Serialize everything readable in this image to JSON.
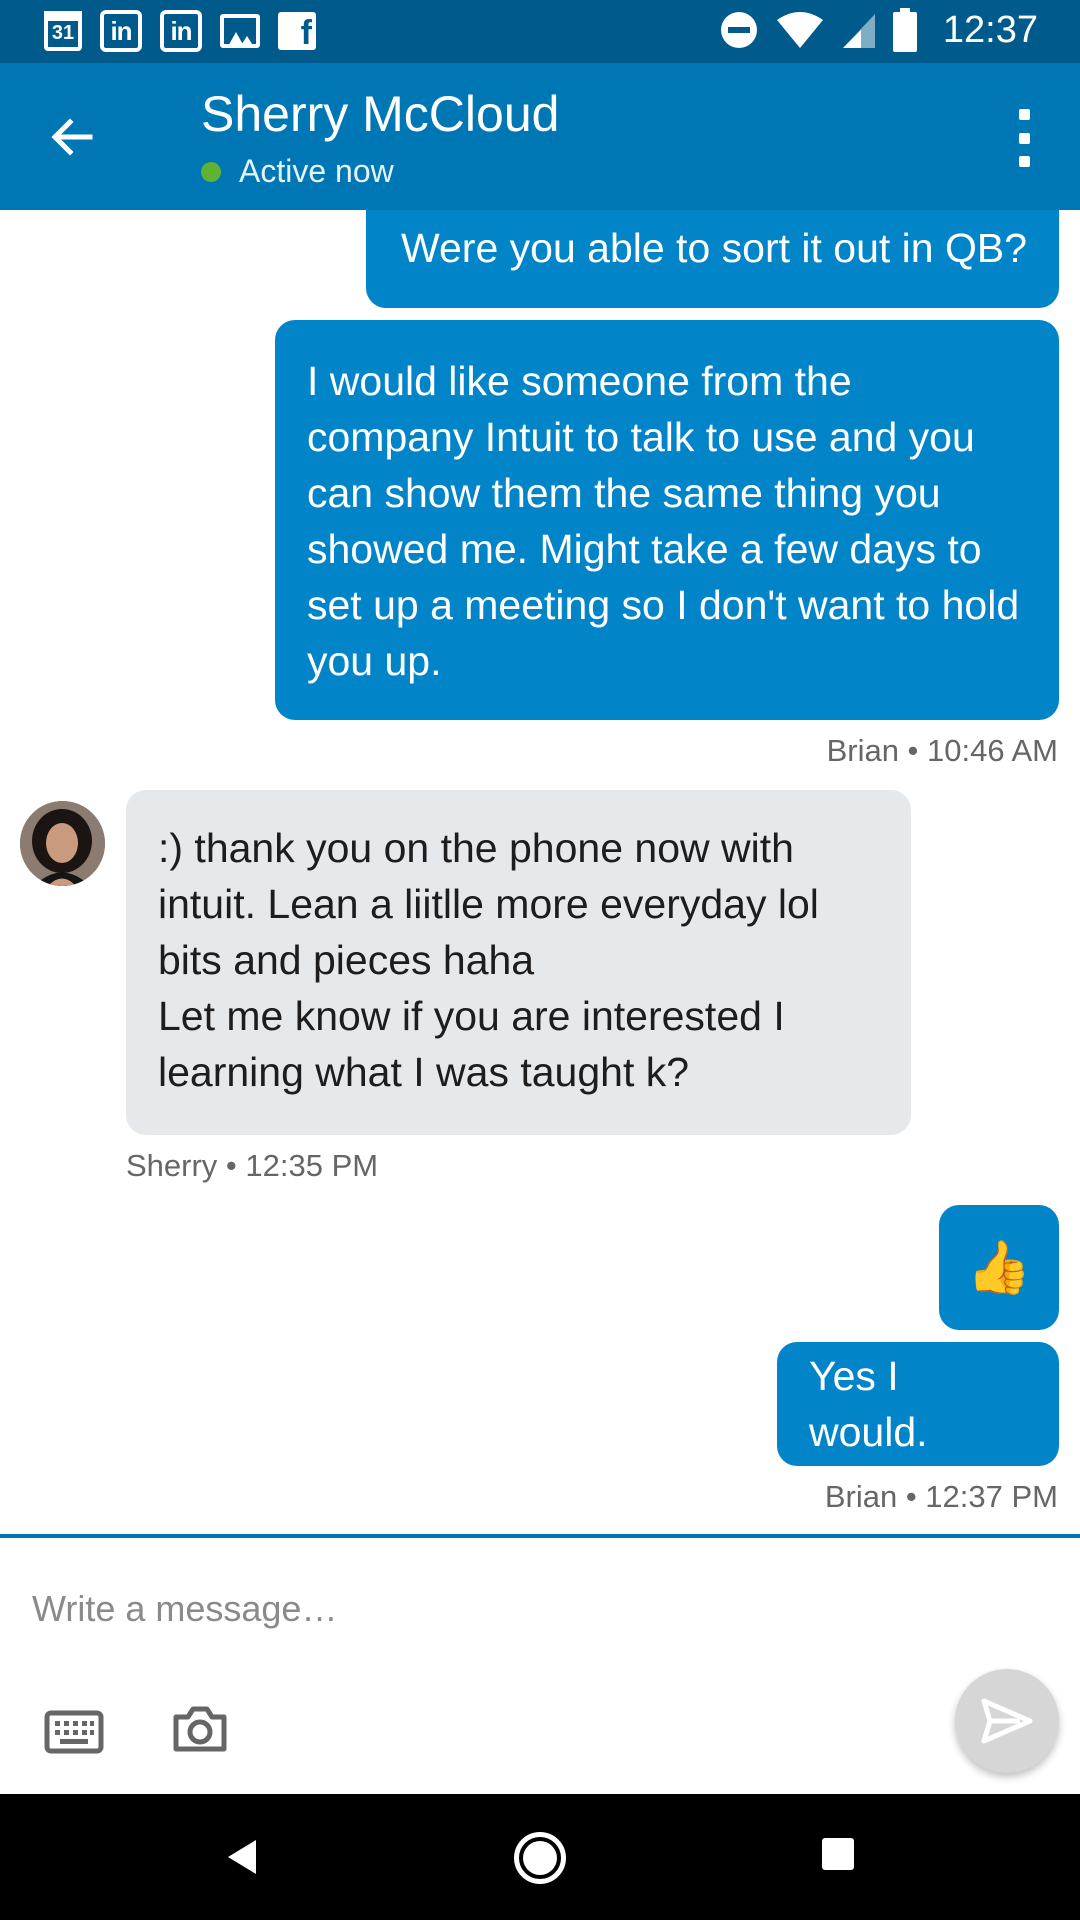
{
  "status_bar": {
    "time": "12:37",
    "calendar_day": "31",
    "linkedin_glyph": "in",
    "facebook_glyph": "f",
    "icons": [
      "calendar-icon",
      "linkedin-icon",
      "linkedin-icon",
      "image-icon",
      "facebook-icon",
      "do-not-disturb-icon",
      "wifi-icon",
      "cell-signal-icon",
      "battery-icon"
    ]
  },
  "header": {
    "contact_name": "Sherry McCloud",
    "presence": "Active now",
    "presence_color": "#5fb233",
    "brand_color": "#0077b5"
  },
  "messages": [
    {
      "direction": "out",
      "text": "Were you able to sort it out in QB?"
    },
    {
      "direction": "out",
      "text": "I would like someone from the company Intuit to talk to use and you can show them the same thing you showed me. Might take a few days to set up a meeting so I don't want to hold you up."
    },
    {
      "direction": "in",
      "text": ":) thank you on the phone now with intuit. Lean a liitlle more everyday lol bits and pieces haha\nLet me know if you are interested I learning what I was taught k?"
    },
    {
      "direction": "out",
      "text": "👍"
    },
    {
      "direction": "out",
      "text": "Yes I would."
    }
  ],
  "meta": {
    "brian_1046": "Brian • 10:46 AM",
    "sherry_1235": "Sherry • 12:35 PM",
    "brian_1237": "Brian • 12:37 PM"
  },
  "composer": {
    "placeholder": "Write a message…"
  }
}
